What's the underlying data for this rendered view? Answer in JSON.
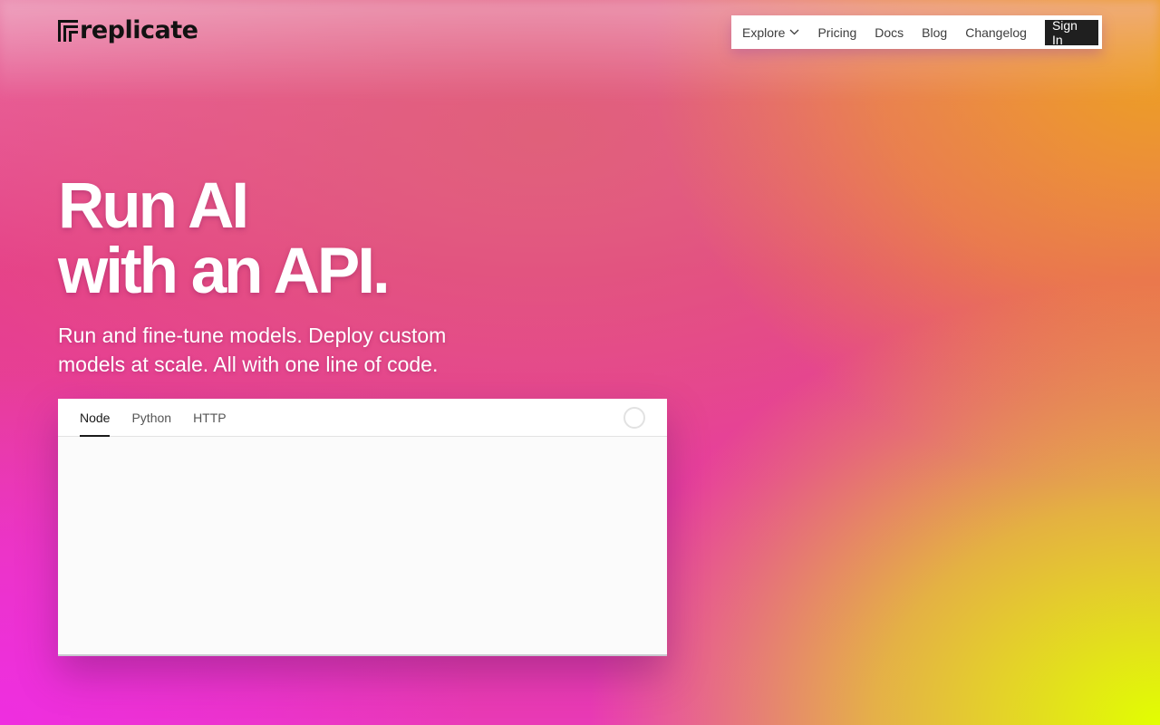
{
  "brand": {
    "name": "replicate",
    "logo_icon": "replicate-logo-icon"
  },
  "nav": {
    "items": [
      {
        "label": "Explore",
        "has_dropdown": true
      },
      {
        "label": "Pricing"
      },
      {
        "label": "Docs"
      },
      {
        "label": "Blog"
      },
      {
        "label": "Changelog"
      }
    ],
    "sign_in": "Sign In"
  },
  "hero": {
    "title_line1": "Run AI",
    "title_line2": "with an API.",
    "subtitle_line1": "Run and fine-tune models. Deploy custom",
    "subtitle_line2": "models at scale. All with one line of code."
  },
  "code_panel": {
    "tabs": [
      {
        "label": "Node",
        "active": true
      },
      {
        "label": "Python",
        "active": false
      },
      {
        "label": "HTTP",
        "active": false
      }
    ],
    "loading_icon": "loading-spinner-icon"
  },
  "colors": {
    "nav_bg": "#ffffff",
    "sign_in_bg": "#1f1f1f",
    "gradient_pink": "#e6408a",
    "gradient_magenta": "#ee2ee0",
    "gradient_orange": "#eda020",
    "gradient_lime": "#e2ff00"
  }
}
